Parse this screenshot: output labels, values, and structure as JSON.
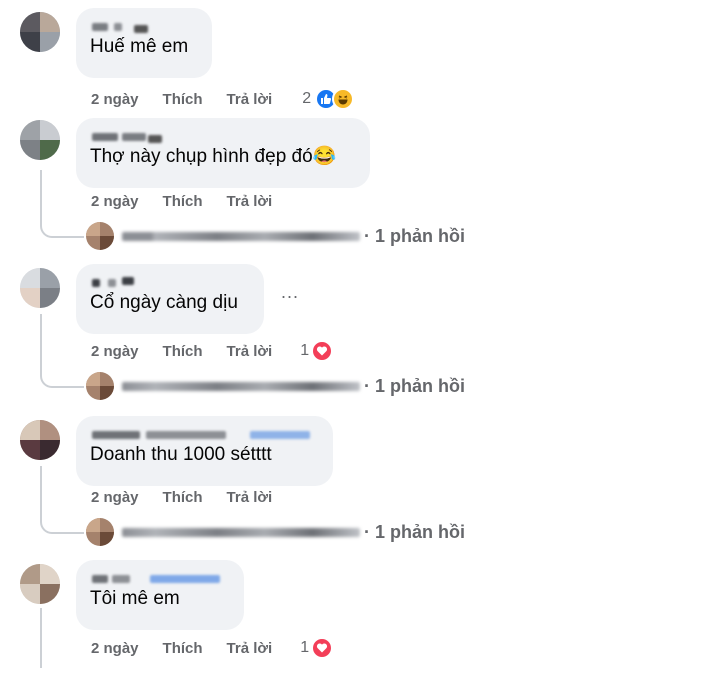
{
  "comments": [
    {
      "text": "Huế mê em",
      "time": "2 ngày",
      "like": "Thích",
      "reply": "Trả lời",
      "reaction_count": "2",
      "reactions": [
        "like-icon",
        "haha-icon"
      ]
    },
    {
      "text": "Thợ này chụp hình đẹp đó😂",
      "time": "2 ngày",
      "like": "Thích",
      "reply": "Trả lời",
      "reply_summary": "· 1 phản hồi"
    },
    {
      "text": "Cổ ngày càng dịu",
      "time": "2 ngày",
      "like": "Thích",
      "reply": "Trả lời",
      "reaction_count": "1",
      "reactions": [
        "heart-icon"
      ],
      "more": "...",
      "reply_summary": "· 1 phản hồi"
    },
    {
      "text": "Doanh thu 1000 sétttt",
      "time": "2 ngày",
      "like": "Thích",
      "reply": "Trả lời",
      "reply_summary": "· 1 phản hồi"
    },
    {
      "text": "Tôi mê em",
      "time": "2 ngày",
      "like": "Thích",
      "reply": "Trả lời",
      "reaction_count": "1",
      "reactions": [
        "heart-icon"
      ]
    }
  ],
  "colors": {
    "bubble": "#f0f2f5",
    "meta": "#65676b",
    "like": "#1877f2",
    "haha": "#f7b928",
    "heart": "#f33e58"
  }
}
